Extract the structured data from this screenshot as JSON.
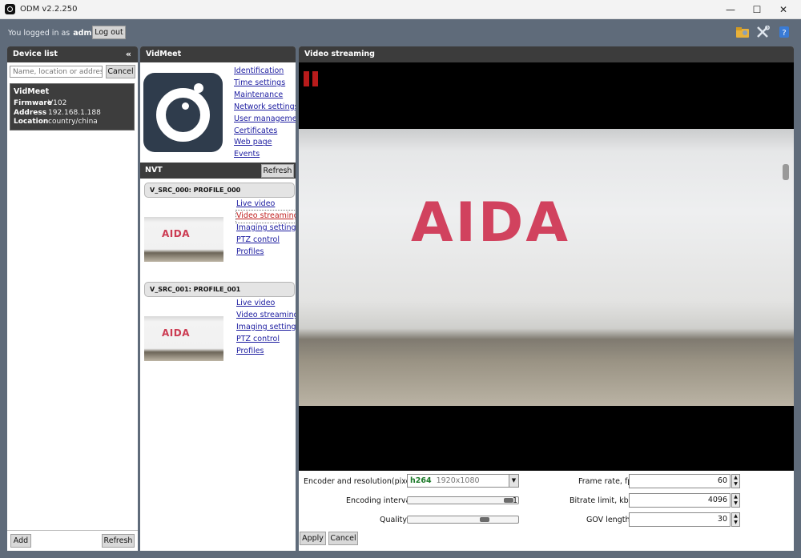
{
  "window": {
    "title": "ODM v2.2.250",
    "minimize": "—",
    "maximize": "☐",
    "close": "✕"
  },
  "login": {
    "prefix": "You logged in as",
    "user": "admin",
    "logout": "Log out"
  },
  "device_list": {
    "title": "Device list",
    "collapse": "«",
    "search_placeholder": "Name, location or address",
    "cancel": "Cancel",
    "device": {
      "name": "VidMeet",
      "rows": [
        {
          "key": "Firmware",
          "value": "V102"
        },
        {
          "key": "Address",
          "value": "192.168.1.188"
        },
        {
          "key": "Location",
          "value": "country/china"
        }
      ]
    },
    "add": "Add",
    "refresh": "Refresh"
  },
  "device_panel": {
    "title": "VidMeet",
    "links": [
      "Identification",
      "Time settings",
      "Maintenance",
      "Network settings",
      "User management",
      "Certificates",
      "Web page",
      "Events"
    ],
    "nvt": "NVT",
    "refresh": "Refresh",
    "profiles": [
      {
        "name": "V_SRC_000: PROFILE_000",
        "thumb_text": "AIDA",
        "links": [
          "Live video",
          "Video streaming",
          "Imaging settings",
          "PTZ control",
          "Profiles"
        ]
      },
      {
        "name": "V_SRC_001: PROFILE_001",
        "thumb_text": "AIDA",
        "links": [
          "Live video",
          "Video streaming",
          "Imaging settings",
          "PTZ control",
          "Profiles"
        ]
      }
    ]
  },
  "video": {
    "title": "Video streaming",
    "frame_text": "AIDA",
    "encoder_label": "Encoder and resolution(pixels)",
    "codec": "h264",
    "resolution": "1920x1080",
    "encoding_interval_label": "Encoding interval",
    "encoding_interval_value": "1",
    "quality_label": "Quality",
    "quality_level": 0.72,
    "encoding_interval_level": 0.96,
    "frame_rate_label": "Frame rate, fps",
    "frame_rate": "60",
    "bitrate_label": "Bitrate limit, kbps",
    "bitrate": "4096",
    "gov_label": "GOV length",
    "gov": "30",
    "apply": "Apply",
    "cancel": "Cancel"
  }
}
